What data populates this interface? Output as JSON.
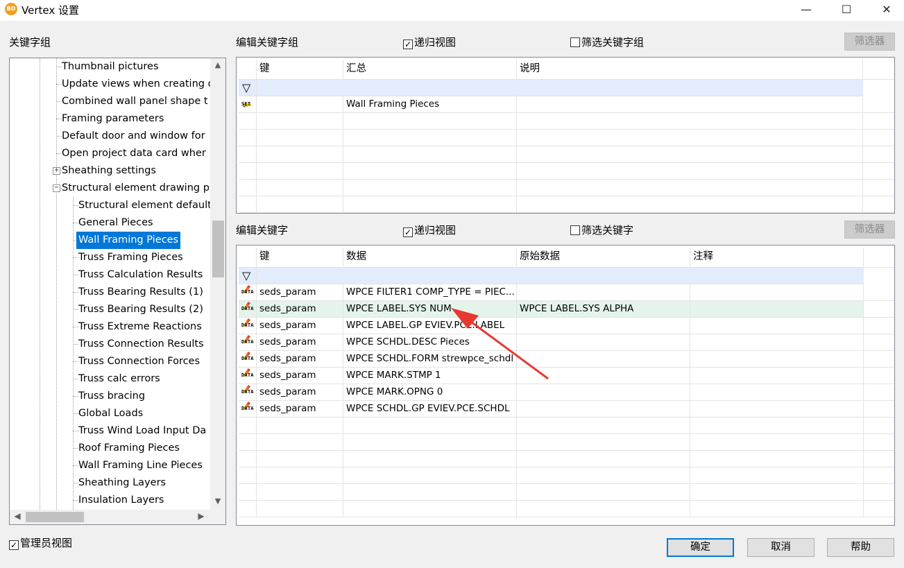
{
  "window": {
    "app_icon_text": "BD",
    "title": "Vertex 设置",
    "minimize_glyph": "—",
    "maximize_glyph": "☐",
    "close_glyph": "✕"
  },
  "left_panel": {
    "heading": "关键字组",
    "tree_items": [
      {
        "label": "Thumbnail pictures",
        "level": 2
      },
      {
        "label": "Update views when creating d",
        "level": 2
      },
      {
        "label": "Combined wall panel shape t",
        "level": 2
      },
      {
        "label": "Framing parameters",
        "level": 2
      },
      {
        "label": "Default door and window for",
        "level": 2
      },
      {
        "label": "Open project data card wher",
        "level": 2
      },
      {
        "label": "Sheathing settings",
        "level": 2,
        "expander": "+"
      },
      {
        "label": "Structural element drawing p",
        "level": 2,
        "expander": "−"
      },
      {
        "label": "Structural element default",
        "level": 3
      },
      {
        "label": "General Pieces",
        "level": 3
      },
      {
        "label": "Wall Framing Pieces",
        "level": 3,
        "selected": true
      },
      {
        "label": "Truss Framing Pieces",
        "level": 3
      },
      {
        "label": "Truss Calculation Results",
        "level": 3
      },
      {
        "label": "Truss Bearing Results (1)",
        "level": 3
      },
      {
        "label": "Truss Bearing Results (2)",
        "level": 3
      },
      {
        "label": "Truss Extreme Reactions",
        "level": 3
      },
      {
        "label": "Truss Connection Results",
        "level": 3
      },
      {
        "label": "Truss Connection Forces",
        "level": 3
      },
      {
        "label": "Truss calc errors",
        "level": 3
      },
      {
        "label": "Truss bracing",
        "level": 3
      },
      {
        "label": "Global Loads",
        "level": 3
      },
      {
        "label": "Truss Wind Load Input Da",
        "level": 3
      },
      {
        "label": "Roof Framing Pieces",
        "level": 3
      },
      {
        "label": "Wall Framing Line Pieces",
        "level": 3
      },
      {
        "label": "Sheathing Layers",
        "level": 3
      },
      {
        "label": "Insulation Layers",
        "level": 3
      }
    ],
    "admin_view_label": "管理员视图",
    "admin_view_checked": "✓"
  },
  "top_section": {
    "heading": "编辑关键字组",
    "recursive_label": "递归视图",
    "recursive_checked": "✓",
    "filter_label": "筛选关键字组",
    "filter_button": "筛选器",
    "columns": [
      "键",
      "汇总",
      "说明"
    ],
    "rows": [
      {
        "icon": "set-icon",
        "icon_text": "SET",
        "key": "",
        "summary": "Wall Framing Pieces",
        "desc": ""
      }
    ]
  },
  "bottom_section": {
    "heading": "编辑关键字",
    "recursive_label": "递归视图",
    "recursive_checked": "✓",
    "filter_label": "筛选关键字",
    "filter_button": "筛选器",
    "columns": [
      "键",
      "数据",
      "原始数据",
      "注释"
    ],
    "rows": [
      {
        "icon_text": "DATA",
        "key": "seds_param",
        "data": "WPCE FILTER1 COMP_TYPE = PIEC...",
        "raw": "",
        "note": ""
      },
      {
        "icon_text": "DATA",
        "key": "seds_param",
        "data": "WPCE LABEL.SYS NUM",
        "raw": "WPCE LABEL.SYS ALPHA",
        "note": "",
        "highlight": true
      },
      {
        "icon_text": "DATA",
        "key": "seds_param",
        "data": "WPCE LABEL.GP EVIEV.PCE.LABEL",
        "raw": "",
        "note": ""
      },
      {
        "icon_text": "DATA",
        "key": "seds_param",
        "data": "WPCE SCHDL.DESC Pieces",
        "raw": "",
        "note": ""
      },
      {
        "icon_text": "DATA",
        "key": "seds_param",
        "data": "WPCE SCHDL.FORM strewpce_schdl",
        "raw": "",
        "note": ""
      },
      {
        "icon_text": "DATA",
        "key": "seds_param",
        "data": "WPCE MARK.STMP 1",
        "raw": "",
        "note": ""
      },
      {
        "icon_text": "DATA",
        "key": "seds_param",
        "data": "WPCE MARK.OPNG 0",
        "raw": "",
        "note": ""
      },
      {
        "icon_text": "DATA",
        "key": "seds_param",
        "data": "WPCE SCHDL.GP EVIEV.PCE.SCHDL",
        "raw": "",
        "note": ""
      }
    ]
  },
  "footer": {
    "ok": "确定",
    "cancel": "取消",
    "help": "帮助"
  },
  "colors": {
    "selection": "#0078d7",
    "filter_row": "#e3ecfb",
    "highlight_row": "#e4f4ea",
    "annotation_arrow": "#e8392f"
  }
}
